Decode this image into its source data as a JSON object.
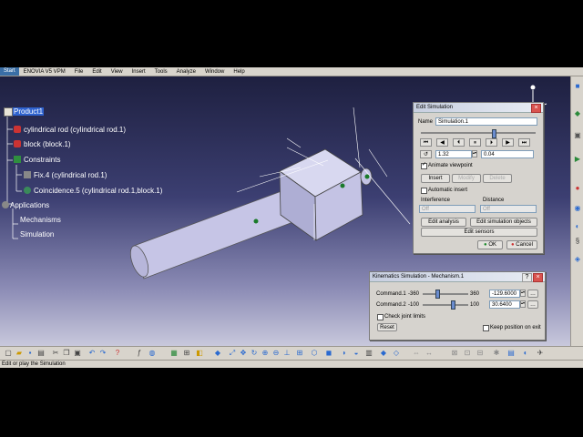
{
  "menubar": {
    "start": "Start",
    "items": [
      "ENOVIA V5 VPM",
      "File",
      "Edit",
      "View",
      "Insert",
      "Tools",
      "Analyze",
      "Window",
      "Help"
    ]
  },
  "tree": {
    "root": "Product1",
    "part1": "cylindrical rod (cylindrical rod.1)",
    "part2": "block (block.1)",
    "constraints": "Constraints",
    "fix": "Fix.4 (cylindrical rod.1)",
    "coincidence": "Coincidence.5 (cylindrical rod.1,block.1)",
    "applications": "Applications",
    "mechanisms": "Mechanisms",
    "simulation": "Simulation"
  },
  "edit_simulation": {
    "title": "Edit Simulation",
    "name_label": "Name",
    "name_value": "Simulation.1",
    "step_value": "1.32",
    "interval_value": "0.04",
    "animate_viewpoint": "Animate viewpoint",
    "insert": "Insert",
    "modify": "Modify",
    "delete": "Delete",
    "automatic_insert": "Automatic insert",
    "interference_label": "Interference",
    "interference_value": "Off",
    "distance_label": "Distance",
    "distance_value": "Off",
    "edit_analysis": "Edit analysis",
    "edit_sim_objects": "Edit simulation objects",
    "edit_sensors": "Edit sensors",
    "ok": "OK",
    "cancel": "Cancel"
  },
  "kinematics": {
    "title": "Kinematics Simulation - Mechanism.1",
    "cmd1_label": "Command.1",
    "cmd1_min": "-360",
    "cmd1_max": "360",
    "cmd1_value": "-129.6000",
    "cmd1_position": 0.32,
    "cmd2_label": "Command.2",
    "cmd2_min": "-100",
    "cmd2_max": "100",
    "cmd2_value": "30.6400",
    "cmd2_position": 0.65,
    "check_joint_limits": "Check joint limits",
    "keep_position": "Keep position on exit",
    "reset": "Reset"
  },
  "status": {
    "text": "Edit or play the Simulation"
  },
  "colors": {
    "selection": "#2f63d0",
    "viewport_top": "#1e2040",
    "viewport_bottom": "#c8c8dc",
    "part_fill": "#c9c8e6"
  }
}
